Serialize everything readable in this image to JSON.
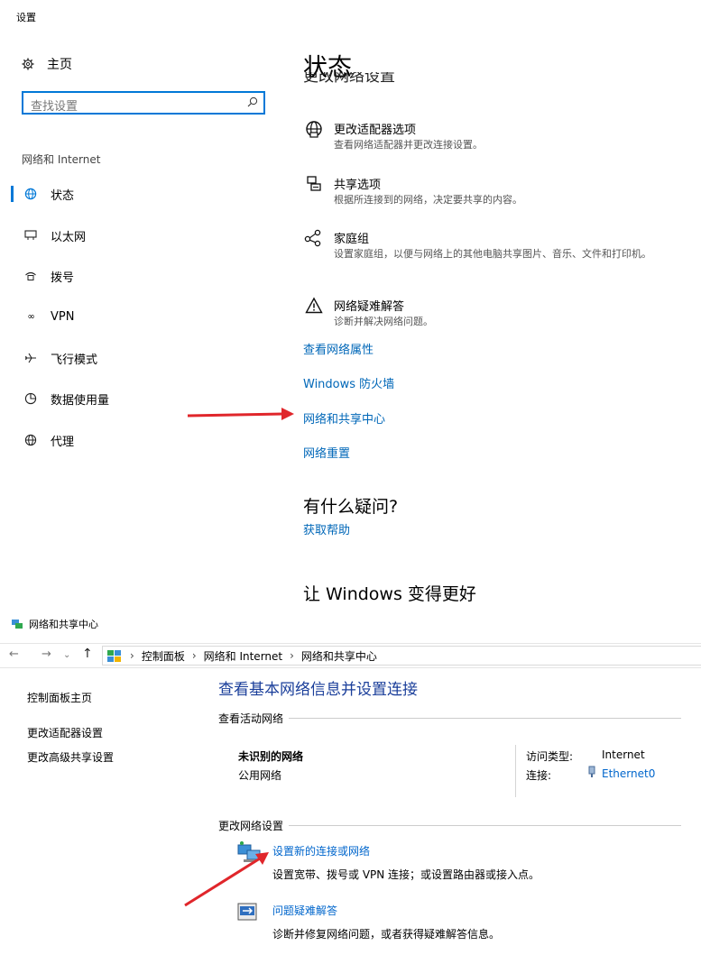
{
  "settings": {
    "app_title": "设置",
    "home_label": "主页",
    "search_placeholder": "查找设置",
    "category": "网络和 Internet",
    "nav": [
      "状态",
      "以太网",
      "拨号",
      "VPN",
      "飞行模式",
      "数据使用量",
      "代理"
    ],
    "page_title": "状态",
    "partial_heading": "更改网络设置",
    "options": [
      {
        "title": "更改适配器选项",
        "desc": "查看网络适配器并更改连接设置。",
        "icon": "globe-icon"
      },
      {
        "title": "共享选项",
        "desc": "根据所连接到的网络，决定要共享的内容。",
        "icon": "share-printer-icon"
      },
      {
        "title": "家庭组",
        "desc": "设置家庭组，以便与网络上的其他电脑共享图片、音乐、文件和打印机。",
        "icon": "homegroup-icon"
      },
      {
        "title": "网络疑难解答",
        "desc": "诊断并解决网络问题。",
        "icon": "warning-icon"
      }
    ],
    "links": [
      "查看网络属性",
      "Windows 防火墙",
      "网络和共享中心",
      "网络重置"
    ],
    "question_heading": "有什么疑问?",
    "help_link": "获取帮助",
    "improve_heading": "让 Windows 变得更好"
  },
  "control_panel": {
    "window_title": "网络和共享中心",
    "breadcrumb": [
      "控制面板",
      "网络和 Internet",
      "网络和共享中心"
    ],
    "side_links": [
      "控制面板主页",
      "更改适配器设置",
      "更改高级共享设置"
    ],
    "main_title": "查看基本网络信息并设置连接",
    "active_networks_label": "查看活动网络",
    "network_name": "未识别的网络",
    "network_type": "公用网络",
    "access_type_label": "访问类型:",
    "access_type_value": "Internet",
    "connection_label": "连接:",
    "connection_value": "Ethernet0",
    "change_settings_label": "更改网络设置",
    "tasks": [
      {
        "title": "设置新的连接或网络",
        "desc": "设置宽带、拨号或 VPN 连接；或设置路由器或接入点。"
      },
      {
        "title": "问题疑难解答",
        "desc": "诊断并修复网络问题，或者获得疑难解答信息。"
      }
    ]
  },
  "colors": {
    "accent": "#0078d7",
    "link": "#0067b8",
    "annotation_arrow": "#e0262b"
  }
}
